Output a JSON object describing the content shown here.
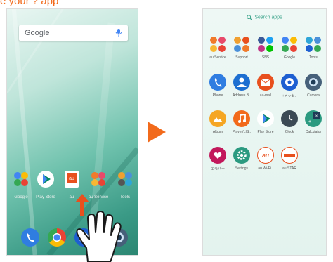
{
  "title": "e your ?    app",
  "left_phone": {
    "search_label": "Google",
    "home_apps": [
      {
        "label": "Google",
        "icon": "folder-icon"
      },
      {
        "label": "Play Store",
        "icon": "play-store-icon"
      },
      {
        "label": "au",
        "icon": "au-icon"
      },
      {
        "label": "au Service",
        "icon": "folder-icon"
      },
      {
        "label": "Tools",
        "icon": "folder-icon"
      }
    ],
    "dock": [
      {
        "icon": "phone-icon"
      },
      {
        "icon": "chrome-icon"
      },
      {
        "icon": "messages-icon"
      },
      {
        "icon": "camera-icon"
      }
    ]
  },
  "right_phone": {
    "search_placeholder": "Search apps",
    "apps": [
      {
        "label": "au Service",
        "icon": "folder-icon"
      },
      {
        "label": "Support",
        "icon": "folder-icon"
      },
      {
        "label": "SNS",
        "icon": "folder-icon"
      },
      {
        "label": "Google",
        "icon": "folder-icon"
      },
      {
        "label": "Tools",
        "icon": "folder-icon"
      },
      {
        "label": "Phone",
        "icon": "phone-icon"
      },
      {
        "label": "Address B..",
        "icon": "contacts-icon"
      },
      {
        "label": "au-mail",
        "icon": "mail-icon"
      },
      {
        "label": "+メッセ..",
        "icon": "messages-icon"
      },
      {
        "label": "Camera",
        "icon": "camera-icon"
      },
      {
        "label": "Album",
        "icon": "album-icon"
      },
      {
        "label": "Player(LIS..",
        "icon": "music-icon"
      },
      {
        "label": "Play Store",
        "icon": "play-store-icon"
      },
      {
        "label": "Clock",
        "icon": "clock-icon"
      },
      {
        "label": "Calculator",
        "icon": "calculator-icon"
      },
      {
        "label": "エモパー",
        "icon": "emopa-icon"
      },
      {
        "label": "Settings",
        "icon": "settings-icon"
      },
      {
        "label": "au Wi-Fi..",
        "icon": "au-wifi-icon"
      },
      {
        "label": "au STAR",
        "icon": "au-star-icon"
      }
    ]
  },
  "colors": {
    "accent": "#f26a1b",
    "teal": "#3aa38a"
  }
}
